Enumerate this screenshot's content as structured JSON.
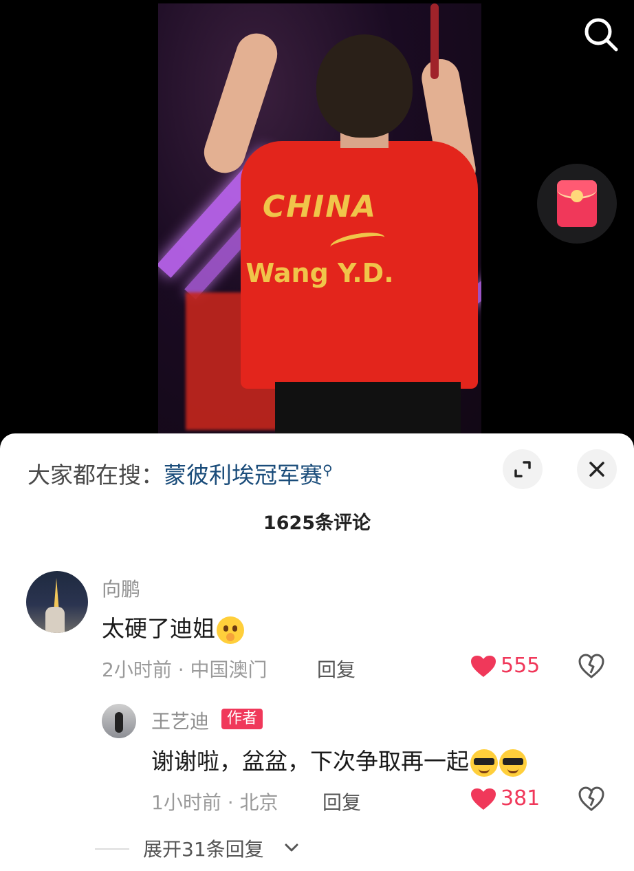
{
  "hot_search": {
    "prefix": "大家都在搜：",
    "term": "蒙彼利埃冠军赛"
  },
  "video": {
    "jersey_line1": "CHINA",
    "jersey_line2": "Wang Y.D."
  },
  "comment_count": "1625条评论",
  "comments": [
    {
      "username": "向鹏",
      "text": "太硬了迪姐",
      "emojis": [
        "shy-emoji"
      ],
      "time": "2小时前",
      "location": "中国澳门",
      "meta": "2小时前 · 中国澳门",
      "reply_label": "回复",
      "likes": "555"
    }
  ],
  "reply": {
    "username": "王艺迪",
    "badge": "作者",
    "text": "谢谢啦，盆盆，下次争取再一起",
    "emojis": [
      "cool-emoji",
      "cool-emoji"
    ],
    "meta": "1小时前 · 北京",
    "reply_label": "回复",
    "likes": "381"
  },
  "expand_replies": "展开31条回复",
  "colors": {
    "accent": "#f0385a",
    "link": "#1a4c7a"
  },
  "icons": [
    "search-icon",
    "red-packet-icon",
    "expand-icon",
    "close-icon",
    "heart-icon",
    "dislike-icon",
    "chevron-down-icon"
  ]
}
